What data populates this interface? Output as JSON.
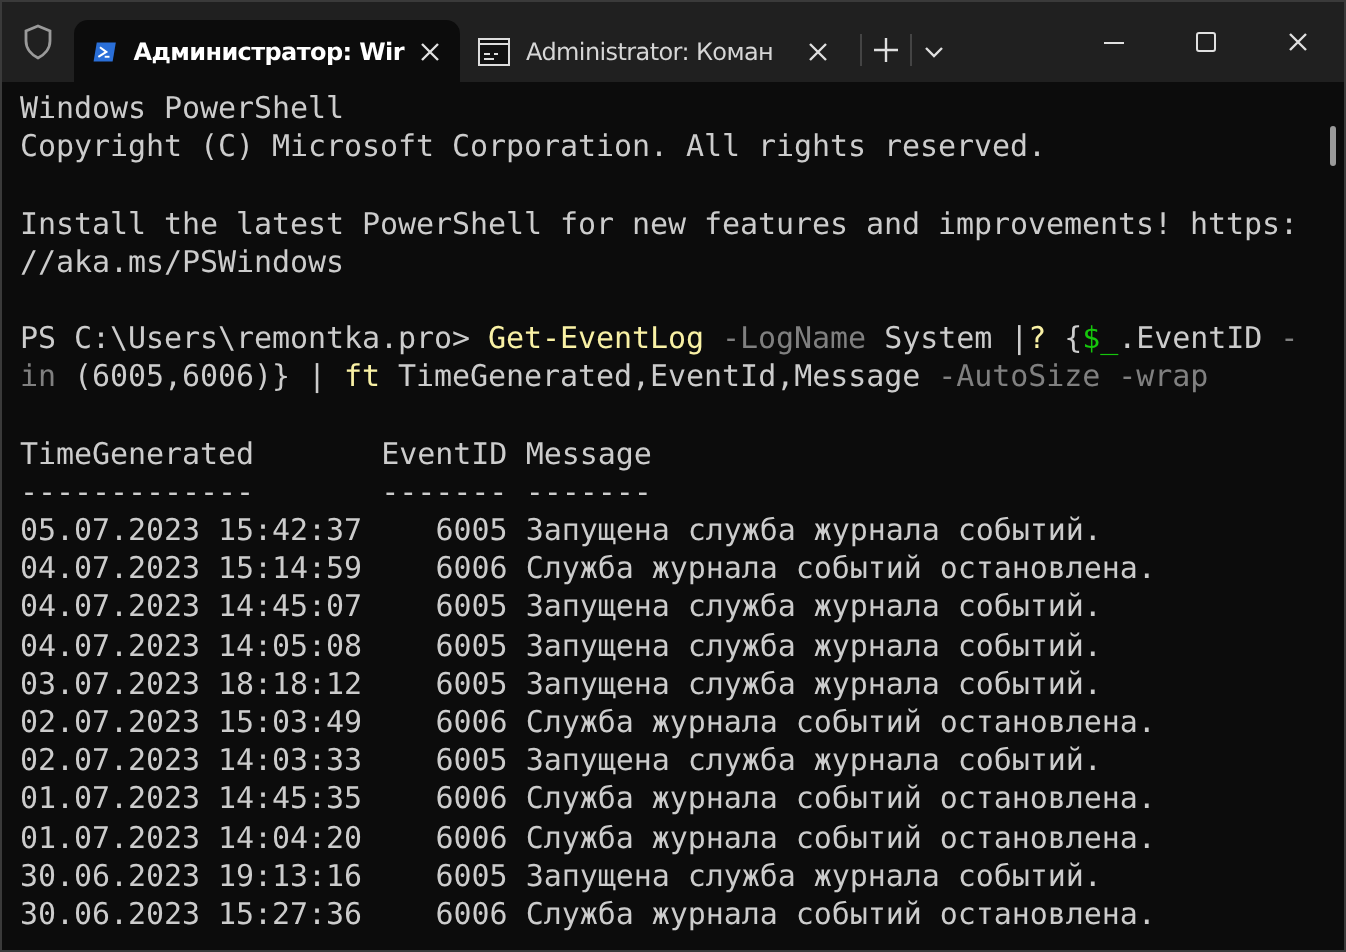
{
  "tabs": [
    {
      "kind": "powershell",
      "title": "Администратор: Wir",
      "selected": true
    },
    {
      "kind": "cmd",
      "title": "Administrator: Коман",
      "selected": false
    }
  ],
  "terminal": {
    "blocks": [
      {
        "lines": [
          [
            {
              "kind": "plain",
              "text": "Windows PowerShell"
            }
          ],
          [
            {
              "kind": "plain",
              "text": "Copyright (C) Microsoft Corporation. All rights reserved."
            }
          ]
        ]
      },
      {
        "lines": [
          [
            {
              "kind": "plain",
              "text": "Install the latest PowerShell for new features and improvements! https:"
            }
          ],
          [
            {
              "kind": "plain",
              "text": "//aka.ms/PSWindows"
            }
          ]
        ]
      },
      {
        "lines": [
          [
            {
              "kind": "plain",
              "text": "PS C:\\Users\\remontka.pro> "
            },
            {
              "kind": "command",
              "text": "Get-EventLog"
            },
            {
              "kind": "parameter",
              "text": " -LogName"
            },
            {
              "kind": "plain",
              "text": " System |"
            },
            {
              "kind": "command",
              "text": "?"
            },
            {
              "kind": "plain",
              "text": " {"
            },
            {
              "kind": "variable",
              "text": "$_"
            },
            {
              "kind": "plain",
              "text": ".EventID "
            },
            {
              "kind": "parameter",
              "text": "-"
            }
          ],
          [
            {
              "kind": "parameter",
              "text": "in"
            },
            {
              "kind": "plain",
              "text": " (6005,6006)} | "
            },
            {
              "kind": "command",
              "text": "ft"
            },
            {
              "kind": "plain",
              "text": " TimeGenerated,EventId,Message "
            },
            {
              "kind": "parameter",
              "text": "-AutoSize -wrap"
            }
          ]
        ]
      }
    ],
    "table": {
      "columns": [
        "TimeGenerated",
        "EventID",
        "Message"
      ],
      "rules": [
        "-------------",
        "-------",
        "-------"
      ],
      "rows": [
        [
          "05.07.2023 15:42:37",
          "6005",
          "Запущена служба журнала событий."
        ],
        [
          "04.07.2023 15:14:59",
          "6006",
          "Служба журнала событий остановлена."
        ],
        [
          "04.07.2023 14:45:07",
          "6005",
          "Запущена служба журнала событий."
        ],
        [
          "04.07.2023 14:05:08",
          "6005",
          "Запущена служба журнала событий."
        ],
        [
          "03.07.2023 18:18:12",
          "6005",
          "Запущена служба журнала событий."
        ],
        [
          "02.07.2023 15:03:49",
          "6006",
          "Служба журнала событий остановлена."
        ],
        [
          "02.07.2023 14:03:33",
          "6005",
          "Запущена служба журнала событий."
        ],
        [
          "01.07.2023 14:45:35",
          "6006",
          "Служба журнала событий остановлена."
        ],
        [
          "01.07.2023 14:04:20",
          "6006",
          "Служба журнала событий остановлена."
        ],
        [
          "30.06.2023 19:13:16",
          "6005",
          "Запущена служба журнала событий."
        ],
        [
          "30.06.2023 15:27:36",
          "6006",
          "Служба журнала событий остановлена."
        ]
      ]
    }
  }
}
